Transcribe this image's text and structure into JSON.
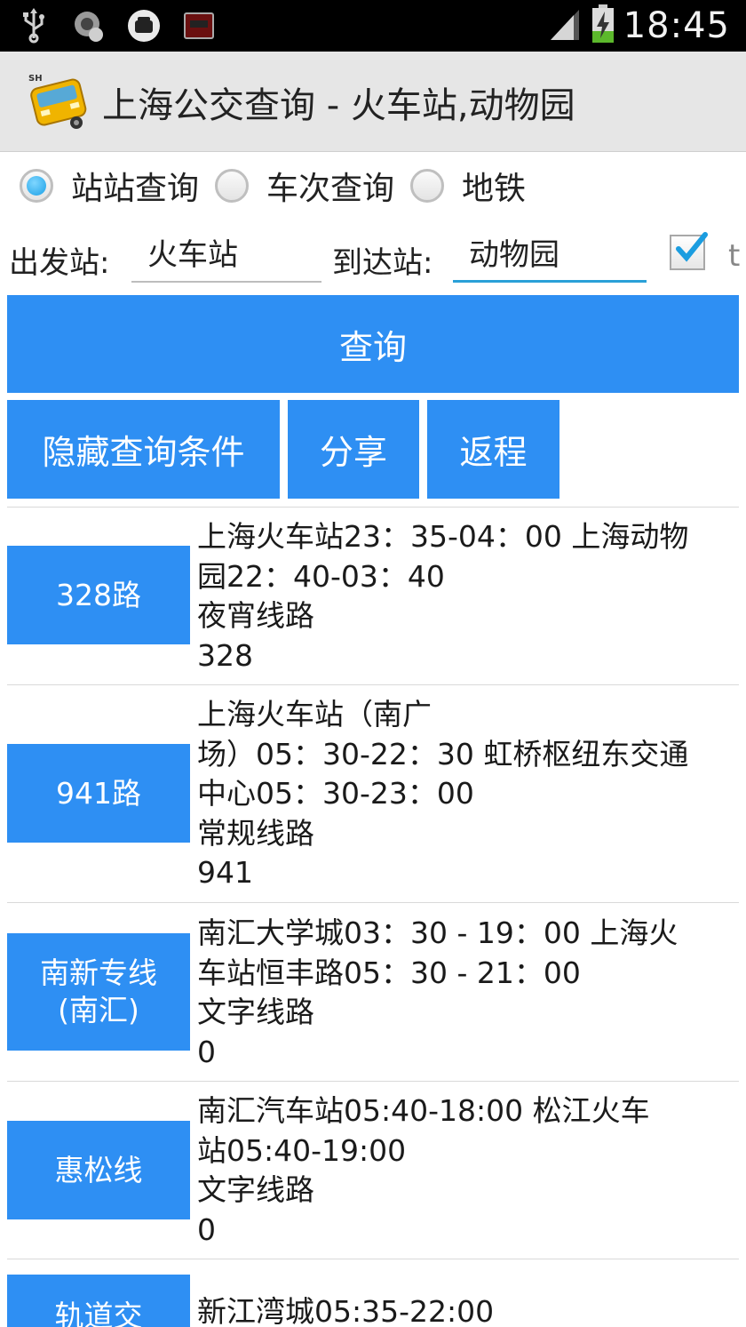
{
  "status_bar": {
    "time": "18:45",
    "left_icons": [
      "usb-icon",
      "voicemail-icon",
      "phone-icon",
      "cassette-icon"
    ],
    "right_icons": [
      "signal-icon",
      "battery-charging-icon"
    ]
  },
  "title_bar": {
    "app_icon_text": "SH",
    "title": "上海公交查询 - 火车站,动物园"
  },
  "query_mode": {
    "options": [
      {
        "label": "站站查询",
        "selected": true
      },
      {
        "label": "车次查询",
        "selected": false
      },
      {
        "label": "地铁",
        "selected": false
      }
    ]
  },
  "stations": {
    "from_label": "出发站:",
    "from_value": "火车站",
    "to_label": "到达站:",
    "to_value": "动物园",
    "checkbox_checked": true,
    "checkbox_label_partial": "t"
  },
  "buttons": {
    "query": "查询",
    "hide_conditions": "隐藏查询条件",
    "share": "分享",
    "return_trip": "返程"
  },
  "colors": {
    "accent": "#2e8ff3",
    "title_bar_bg": "#e6e6e6",
    "input_focus_underline": "#2aa0d8"
  },
  "results": [
    {
      "route": "328路",
      "lines": [
        "上海火车站23：35-04：00 上海动物",
        "园22：40-03：40",
        "夜宵线路",
        "328"
      ]
    },
    {
      "route": "941路",
      "lines": [
        "上海火车站（南广",
        "场）05：30-22：30 虹桥枢纽东交通",
        "中心05：30-23：00",
        "常规线路",
        "941"
      ]
    },
    {
      "route": "南新专线(南汇)",
      "lines": [
        "南汇大学城03：30 - 19：00 上海火",
        "车站恒丰路05：30 - 21：00",
        "文字线路",
        "0"
      ]
    },
    {
      "route": "惠松线",
      "lines": [
        "南汇汽车站05:40-18:00 松江火车",
        "站05:40-19:00",
        "文字线路",
        "0"
      ]
    },
    {
      "route": "轨道交",
      "lines": [
        "新江湾城05:35-22:00"
      ]
    }
  ]
}
